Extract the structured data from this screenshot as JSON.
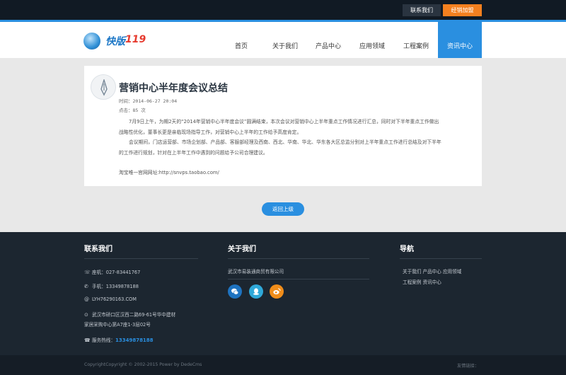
{
  "topbar": {
    "contact_label": "联系我们",
    "join_label": "经销加盟"
  },
  "brand": {
    "logo_cn": "快版",
    "logo_num": "119",
    "accent_color": "#2a8fe0",
    "orange_color": "#f4801f"
  },
  "nav": {
    "items": [
      {
        "label": "首页"
      },
      {
        "label": "关于我们"
      },
      {
        "label": "产品中心"
      },
      {
        "label": "应用领域"
      },
      {
        "label": "工程案例"
      },
      {
        "label": "资讯中心",
        "active": true
      }
    ]
  },
  "article": {
    "title": "营销中心半年度会议总结",
    "time_label": "时间：2014-06-27 20:04",
    "views_label": "点击：85 次",
    "paragraphs": [
      "7月9日上午，为期2天的“2014年营销中心半年度会议”圆满结束，本次会议对营销中心上半年重点工作情况进行汇总，同时对下半年重点工作做出战略性优化，董事长更是亲临现场指导工作，对营销中心上半年的工作给予高度肯定。",
      "会议期间，门店运营部、市场企划部、产品部、客服部经理及西南、西北、华南、华北、华东各大区总监分别对上半年重点工作进行总结及对下半年的工作进行规划，针对在上半年工作中遇到的问题给予公司合理建议。"
    ],
    "shop_line": "淘宝唯一官网网址:http://snvps.taobao.com/"
  },
  "back_button": "返回上级",
  "footer": {
    "contact": {
      "heading": "联系我们",
      "phone": "座机：027-83441767",
      "mobile": "手机：13349878188",
      "email": "LYH76290163.COM",
      "address_line1": "武汉市硚口区汉西二路69-61号华中建材",
      "address_line2": "家居采购中心第A7座1-3层02号",
      "hotline_label": "服务热线：",
      "hotline_number": "13349878188"
    },
    "about": {
      "heading": "关于我们",
      "company": "武汉市易装通商贸有限公司",
      "social_icons": [
        "wechat-icon",
        "qq-icon",
        "weibo-icon"
      ]
    },
    "navigation": {
      "heading": "导航",
      "row1": [
        "关于我们",
        "产品中心",
        "应用领域"
      ],
      "row2": [
        "工程案例",
        "资讯中心"
      ]
    }
  },
  "bottom": {
    "copyright": "CopyrightCopyright © 2002-2015 Power by DedeCms",
    "friend_links": "友情链接："
  }
}
